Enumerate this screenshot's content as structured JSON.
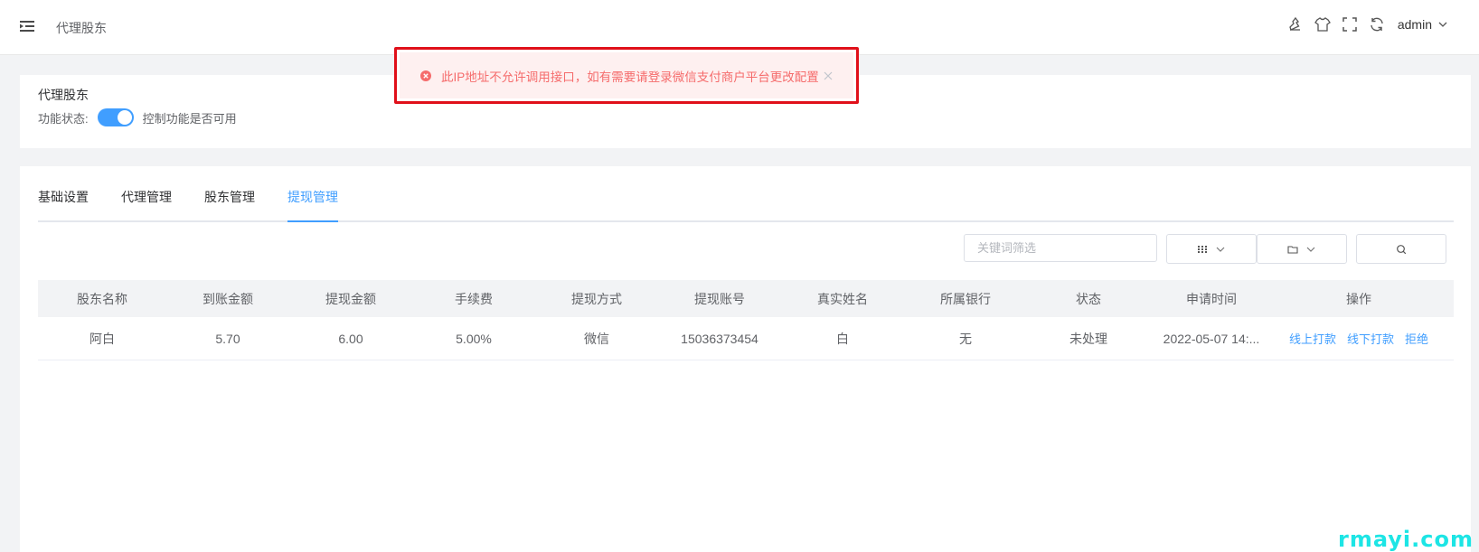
{
  "header": {
    "breadcrumb": "代理股东",
    "user": "admin",
    "icons": [
      "menu-fold-icon",
      "clear-icon",
      "skin-icon",
      "fullscreen-icon",
      "refresh-icon",
      "chevron-down-icon"
    ]
  },
  "toast": {
    "type": "error",
    "message": "此IP地址不允许调用接口，如有需要请登录微信支付商户平台更改配置"
  },
  "settings": {
    "title": "代理股东",
    "status_label": "功能状态:",
    "status_on": true,
    "status_hint": "控制功能是否可用"
  },
  "tabs": [
    {
      "label": "基础设置",
      "active": false
    },
    {
      "label": "代理管理",
      "active": false
    },
    {
      "label": "股东管理",
      "active": false
    },
    {
      "label": "提现管理",
      "active": true
    }
  ],
  "filters": {
    "keyword_placeholder": "关键词筛选"
  },
  "table": {
    "columns": [
      "股东名称",
      "到账金额",
      "提现金额",
      "手续费",
      "提现方式",
      "提现账号",
      "真实姓名",
      "所属银行",
      "状态",
      "申请时间",
      "操作"
    ],
    "rows": [
      {
        "name": "阿白",
        "received": "5.70",
        "amount": "6.00",
        "fee": "5.00%",
        "method": "微信",
        "account": "15036373454",
        "real_name": "白",
        "bank": "无",
        "status": "未处理",
        "time": "2022-05-07 14:...",
        "actions": [
          "线上打款",
          "线下打款",
          "拒绝"
        ]
      }
    ]
  },
  "watermark": "rmayi.com",
  "colors": {
    "accent": "#409eff",
    "error": "#f56c6c",
    "error_bg": "#fef0f0",
    "highlight_border": "#e0101a",
    "watermark": "#1de5e5"
  }
}
